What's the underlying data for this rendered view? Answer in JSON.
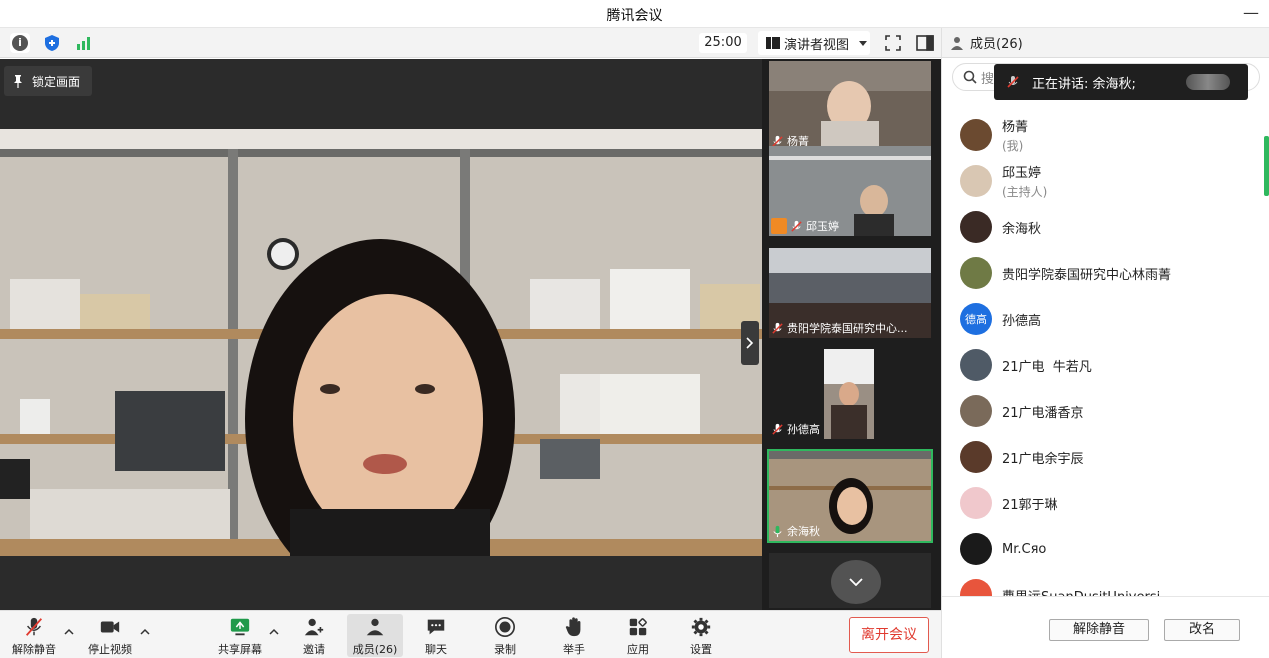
{
  "window": {
    "title": "腾讯会议",
    "minimize_glyph": "—"
  },
  "toolbar": {
    "info_glyph": "i",
    "timer": "25:00",
    "view_mode": "演讲者视图"
  },
  "stage": {
    "lock_label": "锁定画面"
  },
  "thumbnails": [
    {
      "name": "杨菁",
      "mic": "off",
      "bg": "#6d6258"
    },
    {
      "name": "邱玉婷",
      "mic": "off",
      "host_badge": true,
      "bg": "#8a8e90"
    },
    {
      "name": "贵阳学院泰国研究中心...",
      "mic": "off",
      "bg": "#5b5f66"
    },
    {
      "name": "孙德高",
      "mic": "off",
      "bg": "#9a8f84"
    },
    {
      "name": "余海秋",
      "mic": "on",
      "active": true,
      "bg": "#a8957e"
    }
  ],
  "sidebar": {
    "header": "成员(26)",
    "search_placeholder": "搜",
    "speaking_toast": "正在讲话: 余海秋;",
    "members": [
      {
        "name": "杨菁",
        "sub": "(我)",
        "avatar_color": "#6b4a30",
        "initials": ""
      },
      {
        "name": "邱玉婷",
        "sub": "(主持人)",
        "avatar_color": "#d9c7b3",
        "initials": ""
      },
      {
        "name": "余海秋",
        "sub": "",
        "avatar_color": "#3a2a25",
        "initials": ""
      },
      {
        "name": "贵阳学院泰国研究中心林雨菁",
        "sub": "",
        "avatar_color": "#6f7a45",
        "initials": ""
      },
      {
        "name": "孙德高",
        "sub": "",
        "avatar_color": "#1e6fe0",
        "initials": "德高"
      },
      {
        "name": "21广电  牛若凡",
        "sub": "",
        "avatar_color": "#4f5a66",
        "initials": ""
      },
      {
        "name": "21广电潘香京",
        "sub": "",
        "avatar_color": "#7a6a5a",
        "initials": ""
      },
      {
        "name": "21广电余宇辰",
        "sub": "",
        "avatar_color": "#5a3a2a",
        "initials": ""
      },
      {
        "name": "21郭于琳",
        "sub": "",
        "avatar_color": "#f0c8cc",
        "initials": ""
      },
      {
        "name": "Mr.Cяo",
        "sub": "",
        "avatar_color": "#1a1a1a",
        "initials": ""
      },
      {
        "name": "曹思远SuanDusitUniversi",
        "sub": "",
        "avatar_color": "#e8553c",
        "initials": ""
      }
    ],
    "unmute_all": "解除静音",
    "rename": "改名"
  },
  "bottombar": {
    "items": [
      {
        "label": "解除静音",
        "icon": "mic-muted-icon"
      },
      {
        "label": "停止视频",
        "icon": "video-camera-icon"
      },
      {
        "label": "共享屏幕",
        "icon": "share-screen-icon"
      },
      {
        "label": "邀请",
        "icon": "invite-user-icon"
      },
      {
        "label": "成员(26)",
        "icon": "members-icon"
      },
      {
        "label": "聊天",
        "icon": "chat-icon"
      },
      {
        "label": "录制",
        "icon": "record-icon"
      },
      {
        "label": "举手",
        "icon": "raise-hand-icon"
      },
      {
        "label": "应用",
        "icon": "apps-icon"
      },
      {
        "label": "设置",
        "icon": "settings-gear-icon"
      }
    ],
    "leave": "离开会议"
  },
  "colors": {
    "accent_green": "#2fb85e",
    "leave_red": "#e03a2f",
    "avatar_blue": "#1e6fe0"
  }
}
